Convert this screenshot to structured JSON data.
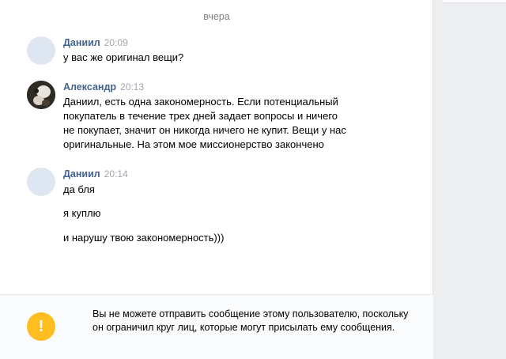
{
  "date_separator": "вчера",
  "messages": [
    {
      "author": "Даниил",
      "time": "20:09",
      "lines": [
        "у вас же оригинал вещи?"
      ]
    },
    {
      "author": "Александр",
      "time": "20:13",
      "lines": [
        "Даниил, есть одна закономерность. Если потенциальный покупатель в течение трех дней задает вопросы и ничего не покупает, значит он никогда ничего не купит. Вещи у нас оригинальные. На этом мое миссионерство закончено"
      ]
    },
    {
      "author": "Даниил",
      "time": "20:14",
      "lines": [
        "да бля",
        "я куплю",
        "и нарушу твою закономерность)))"
      ]
    }
  ],
  "warning": {
    "icon": "!",
    "text": "Вы не можете отправить сообщение этому пользователю, поскольку он ограничил круг лиц, которые могут присылать ему сообщения.",
    "icon_color": "#ffbd1f"
  },
  "colors": {
    "author": "#42648b",
    "time": "#a0a6ad",
    "background": "#edeef0",
    "panel": "#ffffff"
  }
}
